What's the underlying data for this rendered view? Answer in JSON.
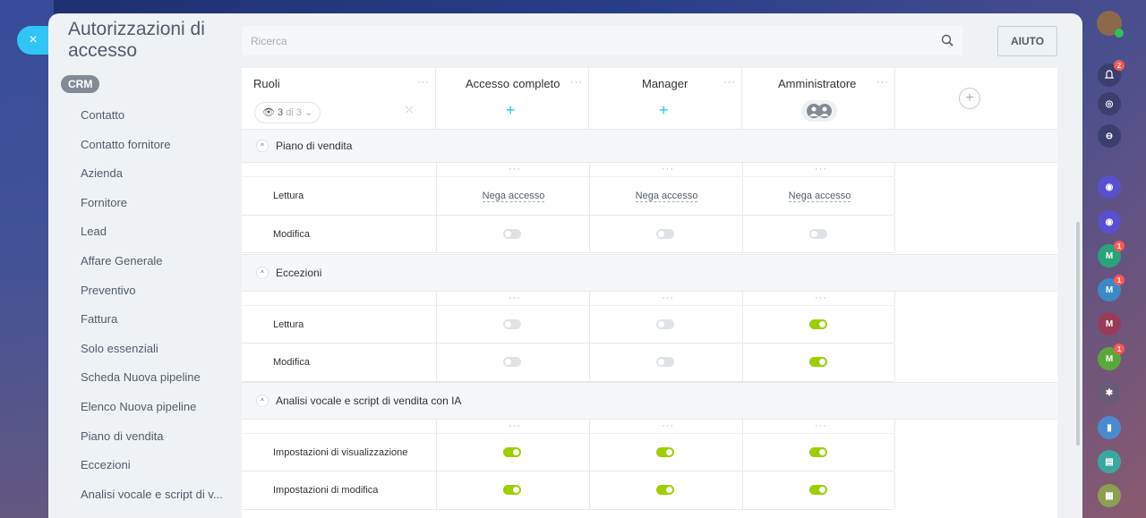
{
  "app": {
    "title": "Autorizzazioni di accesso",
    "close_label": "×"
  },
  "nav": {
    "tag": "CRM",
    "items": [
      {
        "label": "Contatto"
      },
      {
        "label": "Contatto fornitore"
      },
      {
        "label": "Azienda"
      },
      {
        "label": "Fornitore"
      },
      {
        "label": "Lead"
      },
      {
        "label": "Affare Generale"
      },
      {
        "label": "Preventivo"
      },
      {
        "label": "Fattura"
      },
      {
        "label": "Solo essenziali"
      },
      {
        "label": "Scheda Nuova pipeline"
      },
      {
        "label": "Elenco Nuova pipeline"
      },
      {
        "label": "Piano di vendita"
      },
      {
        "label": "Eccezioni"
      },
      {
        "label": "Analisi vocale e script di v..."
      }
    ]
  },
  "search": {
    "placeholder": "Ricerca"
  },
  "help": {
    "label": "AIUTO"
  },
  "grid": {
    "first_col": {
      "title": "Ruoli",
      "dots": "···",
      "filter_count": "3",
      "filter_of": "di 3"
    },
    "roles": [
      {
        "title": "Accesso completo",
        "dots": "···"
      },
      {
        "title": "Manager",
        "dots": "···"
      },
      {
        "title": "Amministratore",
        "dots": "···"
      }
    ],
    "add_role": "+",
    "sections": [
      {
        "title": "Piano di vendita",
        "dots": "···",
        "rows": [
          {
            "label": "Lettura",
            "values": [
              "Nega accesso",
              "Nega accesso",
              "Nega accesso"
            ]
          },
          {
            "label": "Modifica",
            "toggles": [
              false,
              false,
              false
            ]
          }
        ]
      },
      {
        "title": "Eccezioni",
        "dots": "···",
        "rows": [
          {
            "label": "Lettura",
            "toggles": [
              false,
              false,
              true
            ]
          },
          {
            "label": "Modifica",
            "toggles": [
              false,
              false,
              true
            ]
          }
        ]
      },
      {
        "title": "Analisi vocale e script di vendita con IA",
        "dots": "···",
        "rows": [
          {
            "label": "Impostazioni di visualizzazione",
            "toggles": [
              true,
              true,
              true
            ]
          },
          {
            "label": "Impostazioni di modifica",
            "toggles": [
              true,
              true,
              true
            ]
          }
        ]
      }
    ]
  },
  "right_rail": {
    "notifications_badge": "2",
    "chat_badges": [
      "1",
      "1",
      "1"
    ],
    "avatar_letters": [
      "M",
      "M",
      "M",
      "M"
    ],
    "accent": "#9dcf00"
  }
}
